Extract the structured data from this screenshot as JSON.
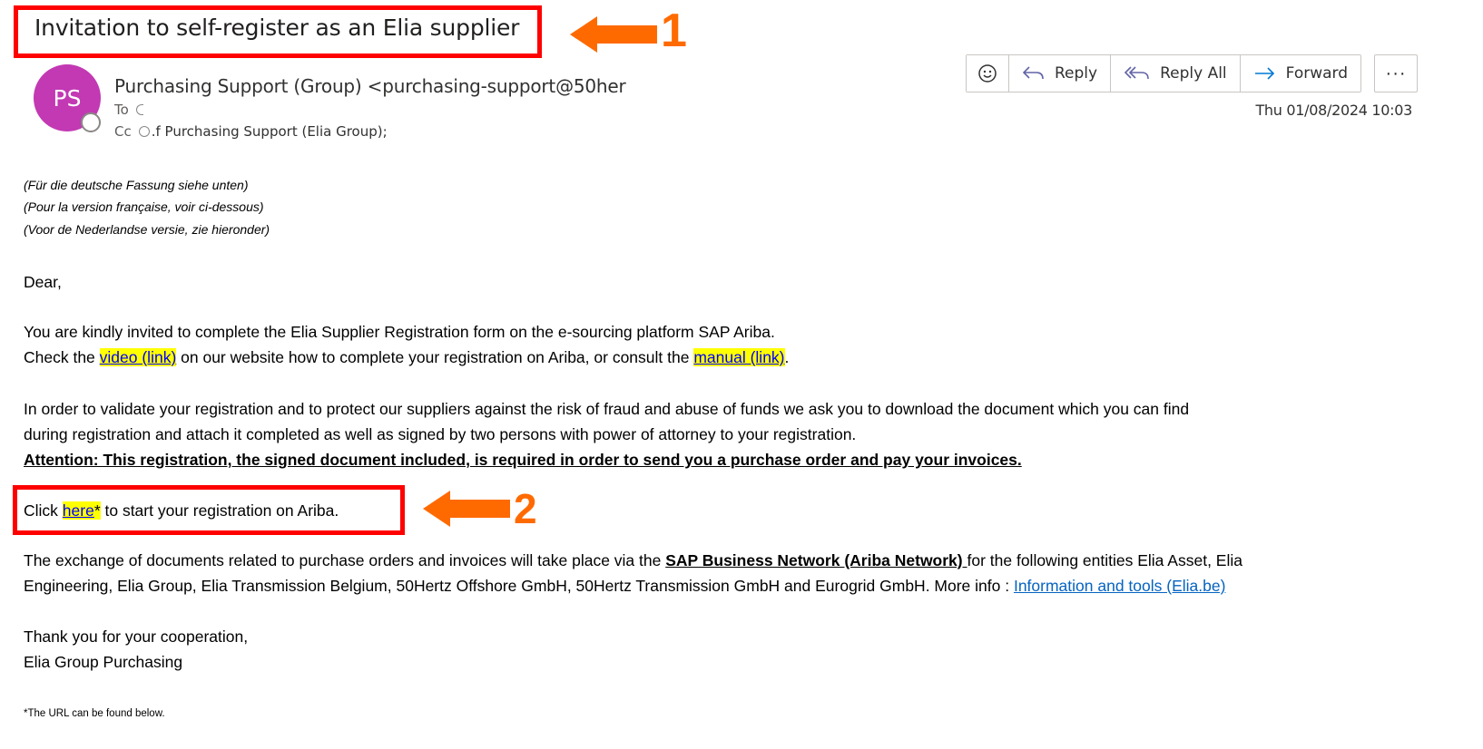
{
  "subject": "Invitation to self-register as an Elia supplier",
  "annotations": [
    {
      "number": "1",
      "color": "#ff6a00"
    },
    {
      "number": "2",
      "color": "#ff6a00"
    }
  ],
  "header": {
    "avatar_initials": "PS",
    "avatar_color": "#c239b3",
    "sender": "Purchasing Support (Group) <purchasing-support@50her",
    "to_label": "To",
    "to_value": "C",
    "cc_label": "Cc",
    "cc_value": ".f Purchasing Support (Elia Group);",
    "date": "Thu 01/08/2024 10:03"
  },
  "toolbar": {
    "emoji_icon": "smiley-icon",
    "reply": "Reply",
    "reply_all": "Reply All",
    "forward": "Forward",
    "more": "···"
  },
  "body": {
    "lang_de": "(Für die deutsche Fassung siehe unten)",
    "lang_fr": "(Pour la version française, voir ci-dessous)",
    "lang_nl": "(Voor de Nederlandse versie, zie hieronder)",
    "greeting": "Dear,",
    "p1_line1": "You are kindly invited to complete the Elia Supplier Registration form on the e-sourcing platform SAP Ariba.",
    "p1_line2_a": "Check the ",
    "video_link": "video (link)",
    "p1_line2_b": " on our website how to complete your registration on Ariba, or consult the ",
    "manual_link": "manual (link)",
    "p1_line2_c": ".",
    "p2_line1": "In order to validate your registration and to protect our suppliers against the risk of fraud and abuse of funds we ask you to download the document which you can find",
    "p2_line2": "during registration and attach it completed as well as signed by two persons with power of attorney to your registration.",
    "attention": "Attention: This registration, the signed document included, is required in order to send you a purchase order and pay your invoices.",
    "click_a": "Click ",
    "here_link": "here",
    "here_star": "*",
    "click_b": " to start your registration on Ariba.",
    "p4_line1_a": "The exchange of documents related to purchase orders and invoices will take place via the ",
    "sap_network": "SAP Business Network (Ariba Network) ",
    "p4_line1_b": "for the following entities Elia Asset, Elia",
    "p4_line2_a": "Engineering, Elia Group, Elia Transmission Belgium, 50Hertz Offshore GmbH, 50Hertz Transmission GmbH and Eurogrid GmbH. More info : ",
    "info_link": "Information and tools (Elia.be)",
    "thanks": "Thank you for your cooperation,",
    "signature": "Elia Group Purchasing",
    "footnote": "*The URL can be found below."
  }
}
